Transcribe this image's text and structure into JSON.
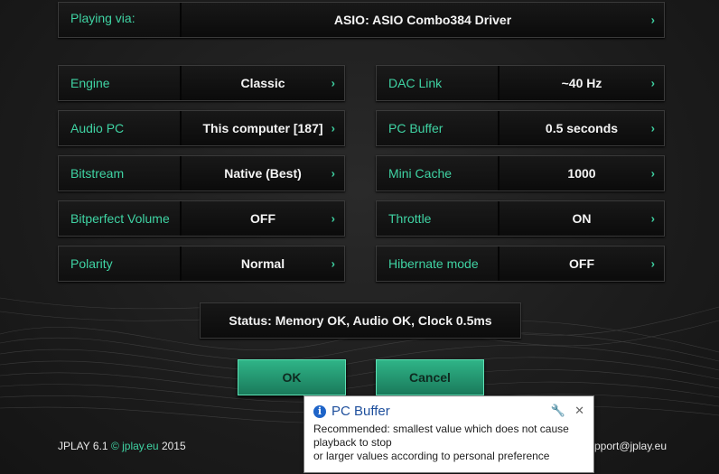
{
  "playing_via": {
    "label": "Playing via:",
    "value": "ASIO: ASIO Combo384 Driver"
  },
  "left_settings": [
    {
      "label": "Engine",
      "value": "Classic"
    },
    {
      "label": "Audio PC",
      "value": "This computer [187]"
    },
    {
      "label": "Bitstream",
      "value": "Native (Best)"
    },
    {
      "label": "Bitperfect Volume",
      "value": "OFF"
    },
    {
      "label": "Polarity",
      "value": "Normal"
    }
  ],
  "right_settings": [
    {
      "label": "DAC Link",
      "value": "~40 Hz"
    },
    {
      "label": "PC Buffer",
      "value": "0.5 seconds"
    },
    {
      "label": "Mini Cache",
      "value": "1000"
    },
    {
      "label": "Throttle",
      "value": "ON"
    },
    {
      "label": "Hibernate mode",
      "value": "OFF"
    }
  ],
  "chevron": "›",
  "status": "Status: Memory OK, Audio OK, Clock 0.5ms",
  "buttons": {
    "ok": "OK",
    "cancel": "Cancel"
  },
  "footer": {
    "version": "JPLAY 6.1",
    "copyright": "© jplay.eu",
    "year": "2015",
    "support": "pport@jplay.eu"
  },
  "tooltip": {
    "title": "PC Buffer",
    "body_line1": "Recommended: smallest value which does not cause",
    "body_line2": "playback to stop",
    "body_line3": "or larger values according to personal preference",
    "icons": [
      "info-icon",
      "wrench-icon",
      "close-icon"
    ]
  },
  "colors": {
    "accent": "#3fd3a3",
    "button": "#2fb487"
  }
}
